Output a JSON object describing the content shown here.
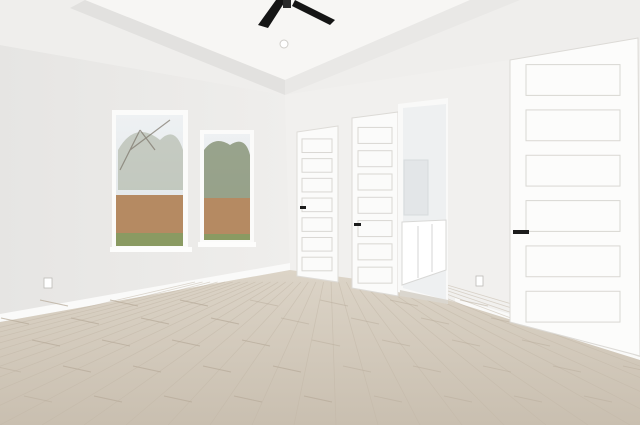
{
  "scene": {
    "subject": "empty-bedroom-interior",
    "colors": {
      "ceiling": "#f1f0ee",
      "tray_ceiling": "#f6f5f3",
      "left_wall": "#ecebe9",
      "back_wall": "#f0efed",
      "right_wall": "#f2f1ef",
      "floor_light": "#d7cdbf",
      "floor_dark": "#b9ad9c",
      "fence": "#b58a62",
      "sky": "#e8ecef",
      "foliage": "#7c8a6a",
      "grass": "#8a9a62",
      "door": "#fbfbfa",
      "door_shadow": "#dcdad6",
      "hardware": "#1c1c1c",
      "fan": "#151515",
      "bathroom": "#eef0f1",
      "vanity": "#ffffff"
    },
    "icons": {
      "fan": "ceiling-fan-icon",
      "light": "recessed-light-icon",
      "outlet": "wall-outlet-icon",
      "handle": "door-lever-icon"
    }
  }
}
